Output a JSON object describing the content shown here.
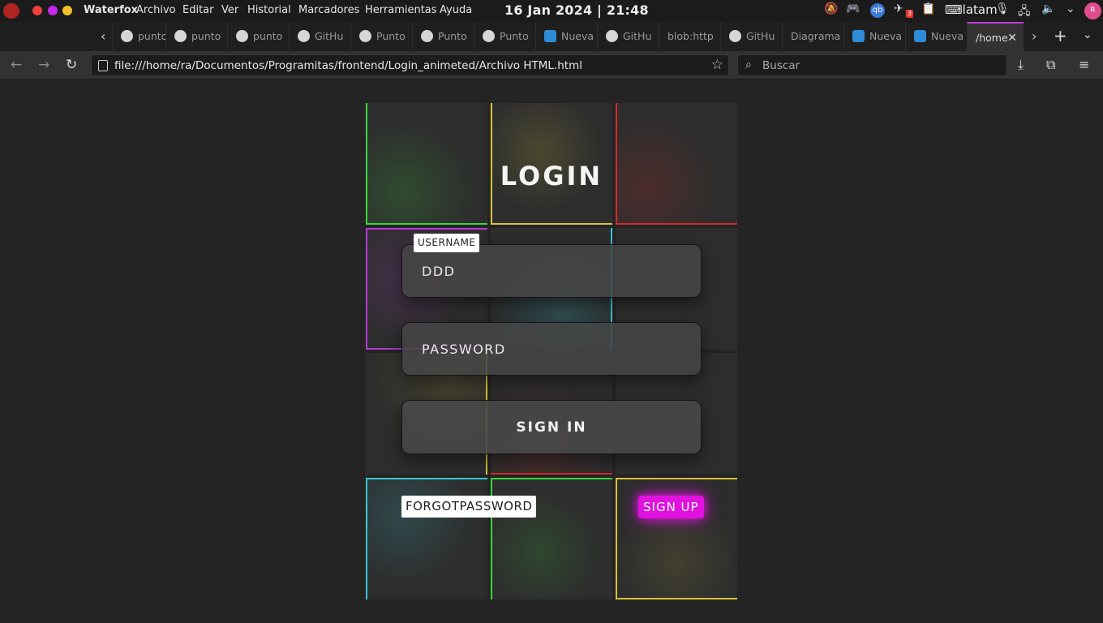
{
  "system": {
    "app_name": "Waterfox",
    "menus": [
      "Archivo",
      "Editar",
      "Ver",
      "Historial",
      "Marcadores",
      "Herramientas",
      "Ayuda"
    ],
    "clock": "16 Jan 2024 | 21:48",
    "tray_badge": "qb",
    "tray_count": "3",
    "keyboard_layout": "latam",
    "avatar_text": "R"
  },
  "tabs": [
    {
      "label": "punto",
      "icon": "github-icon"
    },
    {
      "label": "punto",
      "icon": "github-icon"
    },
    {
      "label": "punto",
      "icon": "github-icon"
    },
    {
      "label": "GitHu",
      "icon": "github-icon"
    },
    {
      "label": "Punto",
      "icon": "github-icon"
    },
    {
      "label": "Punto",
      "icon": "github-icon"
    },
    {
      "label": "Punto",
      "icon": "github-icon"
    },
    {
      "label": "Nueva",
      "icon": "wiki-icon"
    },
    {
      "label": "GitHu",
      "icon": "github-icon"
    },
    {
      "label": "blob:http",
      "icon": ""
    },
    {
      "label": "GitHu",
      "icon": "github-icon"
    },
    {
      "label": "Diagrama",
      "icon": ""
    },
    {
      "label": "Nueva",
      "icon": "wiki-icon"
    },
    {
      "label": "Nueva",
      "icon": "wiki-icon"
    },
    {
      "label": "/home",
      "icon": "",
      "active": true
    }
  ],
  "navbar": {
    "url": "file:///home/ra/Documentos/Programitas/frontend/Login_animeted/Archivo HTML.html",
    "search_placeholder": "Buscar"
  },
  "page": {
    "title": "LOGIN",
    "username_label": "USERNAME",
    "username_value": "DDD",
    "password_placeholder": "PASSWORD",
    "signin_label": "SIGN IN",
    "forgot_label": "FORGOTPASSWORD",
    "signup_label": "SIGN UP"
  },
  "colors": {
    "accent_pink": "#e012df",
    "glow_green": "#3bd63b",
    "glow_yellow": "#d8c33a",
    "glow_red": "#d62a2a",
    "glow_purple": "#b43bd6",
    "glow_cyan": "#3bc6d6"
  }
}
